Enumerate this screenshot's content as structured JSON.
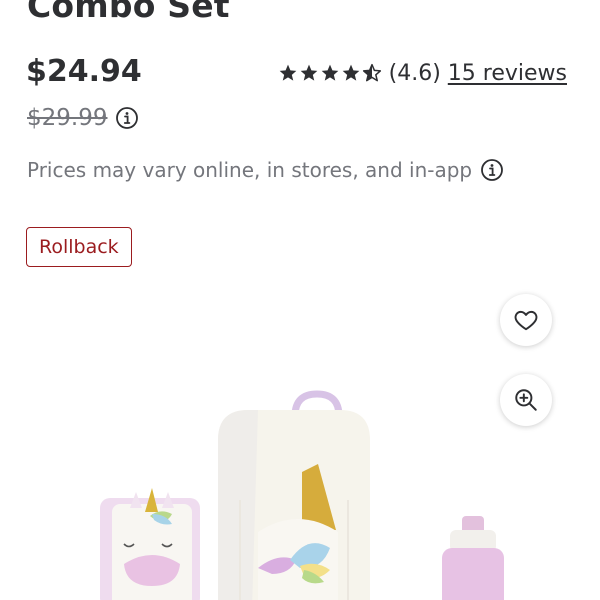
{
  "product": {
    "title": "Combo Set",
    "price": "$24.94",
    "was_price": "$29.99",
    "price_note": "Prices may vary online, in stores, and in-app",
    "badge": "Rollback"
  },
  "rating": {
    "stars": 4.6,
    "display": "(4.6)",
    "reviews_label": "15 reviews"
  },
  "icons": {
    "info": "info-icon",
    "favorite": "heart-outline-icon",
    "zoom": "zoom-in-icon",
    "star": "star-icon"
  },
  "colors": {
    "text": "#2e2f32",
    "muted": "#74767c",
    "rollback": "#9b1c1f"
  }
}
